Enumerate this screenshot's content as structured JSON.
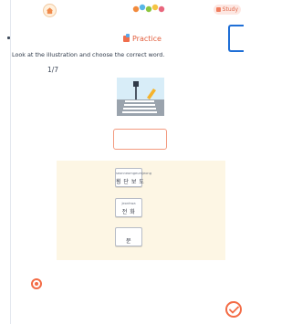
{
  "header": {
    "study_badge": "Study",
    "practice_title": "Practice"
  },
  "question": {
    "instruction": "Look at the illustration and choose the correct word.",
    "counter": "1/7"
  },
  "choices": [
    {
      "romanization": "seonneomgeumjeong",
      "label": "횡 단 보 도"
    },
    {
      "romanization": "jeonhwa",
      "label": "전 화"
    },
    {
      "romanization": "",
      "label": "문"
    }
  ],
  "icons": {
    "home": "home-icon",
    "logo": "app-logo-icon",
    "practice": "practice-icon",
    "illustration": "crosswalk-illustration",
    "record": "record-icon",
    "check": "check-icon"
  },
  "colors": {
    "accent": "#f36b45",
    "panel": "#fdf6e4",
    "highlight": "#1f6fd6"
  }
}
